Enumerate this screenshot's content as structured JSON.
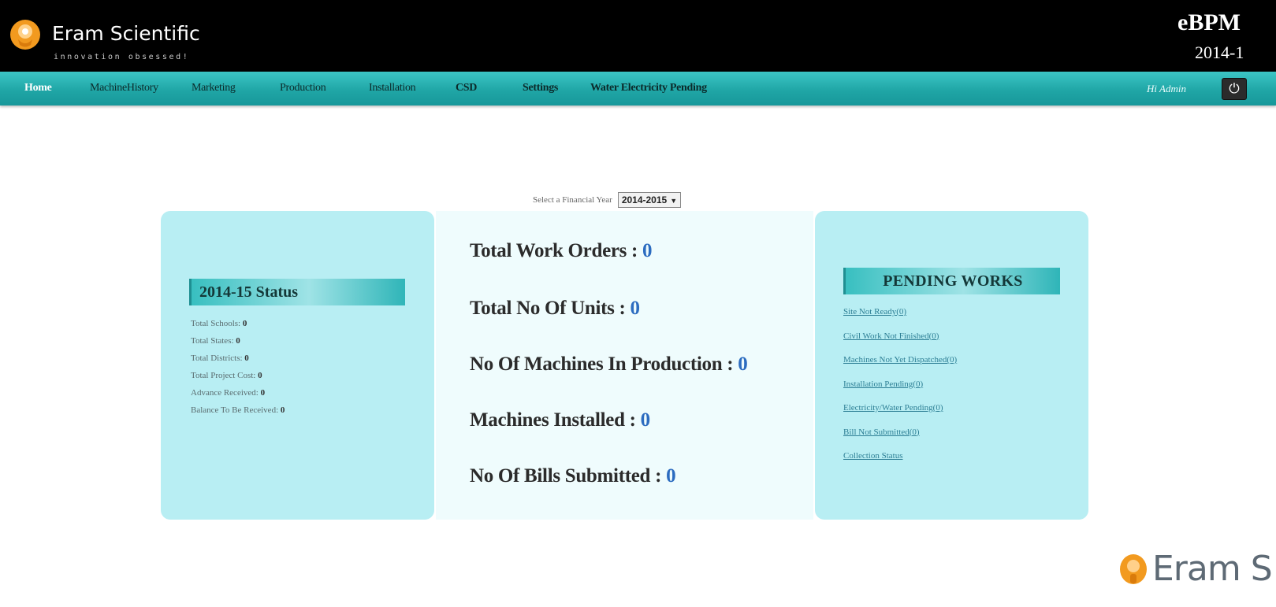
{
  "header": {
    "brand_name": "Eram Scientific",
    "brand_tagline": "innovation obsessed!",
    "app_title": "eBPM",
    "app_year": "2014-1"
  },
  "nav": {
    "items": [
      {
        "label": "Home"
      },
      {
        "label": "MachineHistory"
      },
      {
        "label": "Marketing"
      },
      {
        "label": "Production"
      },
      {
        "label": "Installation"
      },
      {
        "label": "CSD"
      },
      {
        "label": "Settings"
      },
      {
        "label": "Water Electricity Pending"
      }
    ],
    "greeting": "Hi Admin",
    "power_icon": "power-icon"
  },
  "year_selector": {
    "label": "Select a Financial Year",
    "selected": "2014-2015"
  },
  "status_panel": {
    "heading": "2014-15 Status",
    "lines": [
      {
        "label": "Total Schools:",
        "value": "0"
      },
      {
        "label": "Total States:",
        "value": "0"
      },
      {
        "label": "Total Districts:",
        "value": "0"
      },
      {
        "label": "Total Project Cost:",
        "value": "0"
      },
      {
        "label": "Advance Received:",
        "value": "0"
      },
      {
        "label": "Balance To Be Received:",
        "value": "0"
      }
    ]
  },
  "summary": {
    "items": [
      {
        "label": "Total Work Orders :",
        "value": "0"
      },
      {
        "label": "Total No Of Units :",
        "value": "0"
      },
      {
        "label": "No Of Machines In Production :",
        "value": "0"
      },
      {
        "label": "Machines Installed :",
        "value": "0"
      },
      {
        "label": "No Of Bills Submitted :",
        "value": "0"
      }
    ]
  },
  "pending_panel": {
    "heading": "PENDING WORKS",
    "links": [
      "Site Not Ready(0)",
      "Civil Work Not Finished(0)",
      "Machines Not Yet Dispatched(0)",
      "Installation Pending(0)",
      "Electricity/Water Pending(0)",
      "Bill Not Submitted(0)",
      "Collection Status"
    ]
  },
  "footer": {
    "logo_text": "Eram S"
  },
  "colors": {
    "nav_teal": "#20a6a6",
    "panel_cyan": "#b8eef3",
    "value_blue": "#2c6cc0",
    "logo_orange": "#f29a1f"
  }
}
